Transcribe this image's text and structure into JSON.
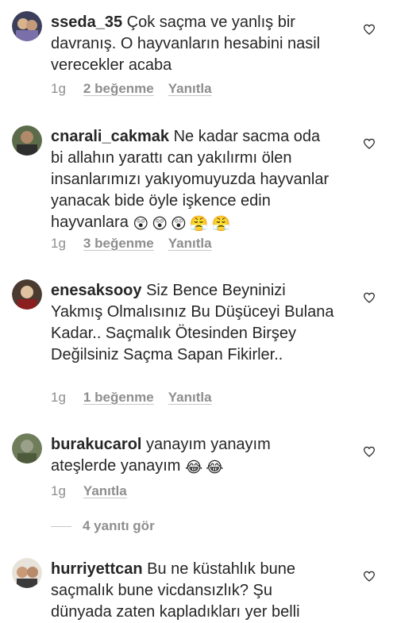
{
  "comments": [
    {
      "username": "sseda_35",
      "text": "Çok saçma ve yanlış bir davranış. O hayvanların hesabini nasil verecekler acaba",
      "time": "1g",
      "likes": "2 beğenme",
      "reply": "Yanıtla"
    },
    {
      "username": "cnarali_cakmak",
      "text": "Ne kadar sacma oda bi allahın yarattı can yakılırmı ölen insanlarımızı yakıyomuyuzda hayvanlar yanacak bide öyle işkence edin hayvanlara",
      "emojis": [
        "😲",
        "😲",
        "😲",
        "😤",
        "😤"
      ],
      "time": "1g",
      "likes": "3 beğenme",
      "reply": "Yanıtla"
    },
    {
      "username": "enesaksooy",
      "text": "Siz Bence Beyninizi Yakmış Olmalısınız Bu Düşüceyi Bulana Kadar.. Saçmalık Ötesinden Birşey Değilsiniz Saçma Sapan Fikirler..",
      "time": "1g",
      "likes": "1 beğenme",
      "reply": "Yanıtla"
    },
    {
      "username": "burakucarol",
      "text": "yanayım yanayım ateşlerde yanayım",
      "emojis": [
        "😂",
        "😂"
      ],
      "time": "1g",
      "reply": "Yanıtla"
    },
    {
      "username": "hurriyettcan",
      "text": "Bu ne küstahlık bune saçmalık bune vicdansızlık? Şu dünyada zaten kapladıkları yer belli"
    }
  ],
  "view_replies": "4 yanıtı gör",
  "icons": {
    "like": "heart-outline-icon"
  },
  "colors": {
    "text": "#262626",
    "meta": "#8e8e8e"
  }
}
